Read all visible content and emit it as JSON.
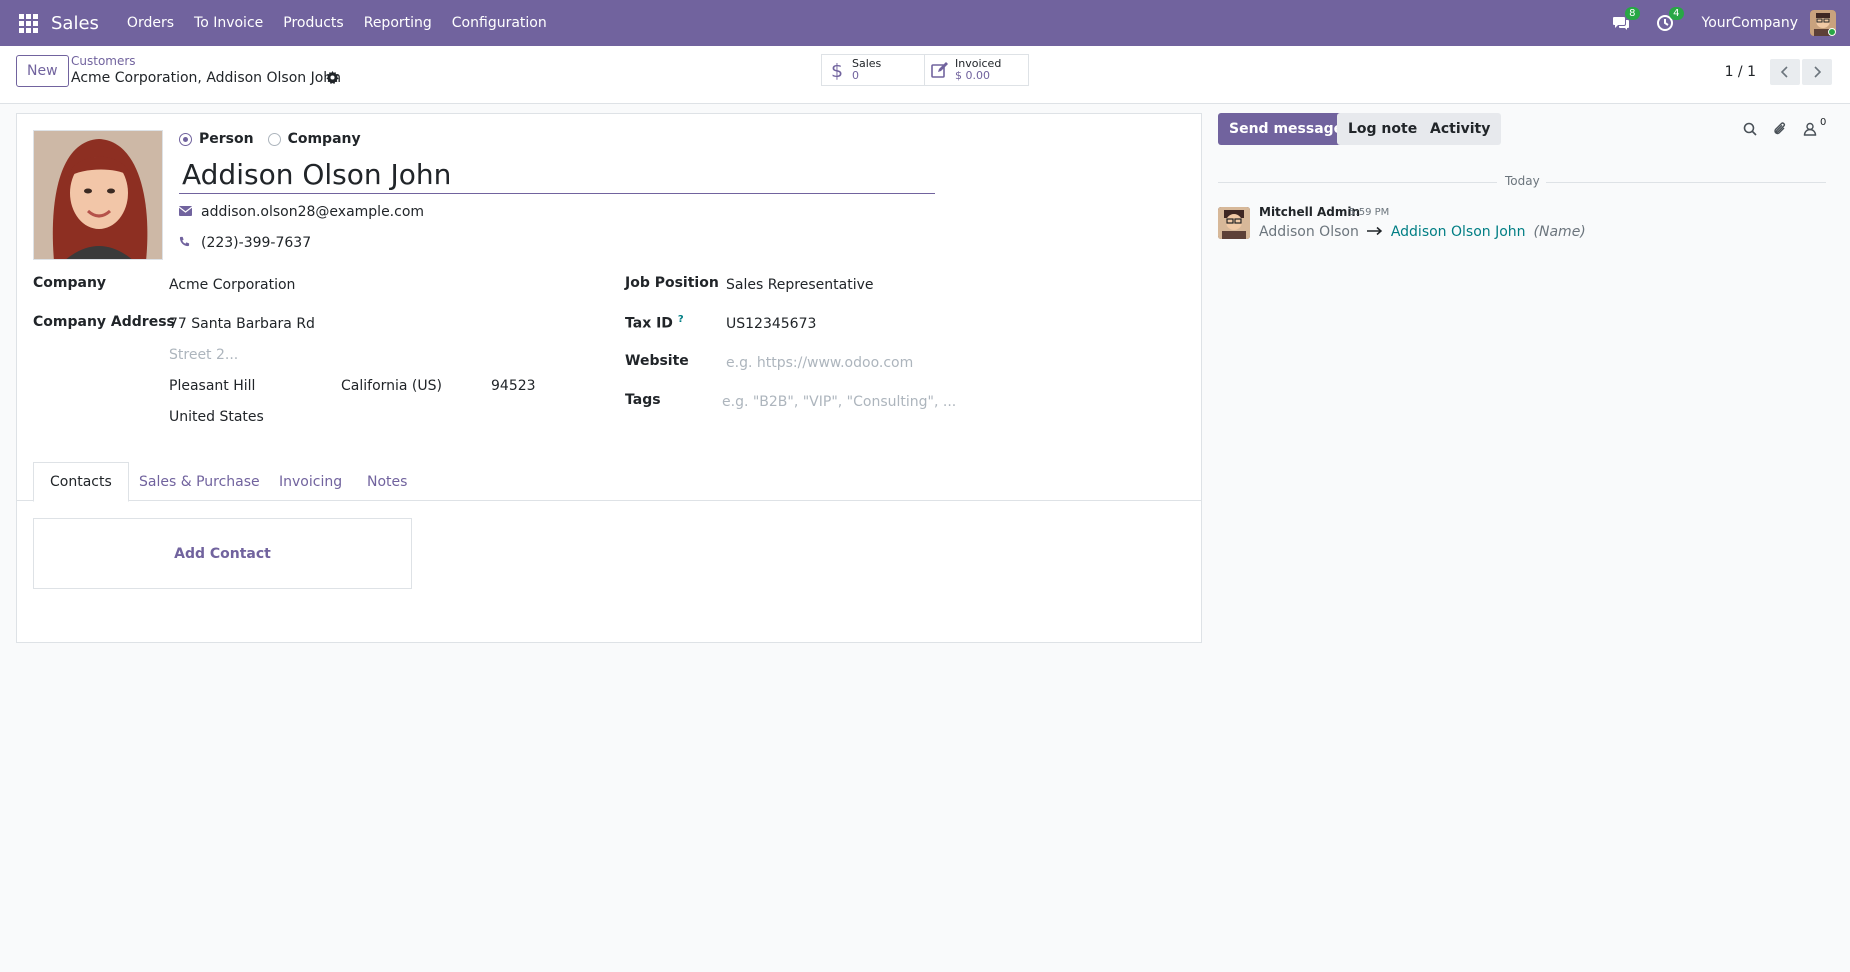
{
  "navbar": {
    "app_name": "Sales",
    "menu": [
      "Orders",
      "To Invoice",
      "Products",
      "Reporting",
      "Configuration"
    ],
    "messages_badge": "8",
    "activities_badge": "4",
    "company": "YourCompany"
  },
  "control_panel": {
    "new_label": "New",
    "breadcrumb_parent": "Customers",
    "breadcrumb_current": "Acme Corporation, Addison Olson John",
    "smart_buttons": [
      {
        "label": "Sales",
        "value": "0",
        "icon": "dollar-icon"
      },
      {
        "label": "Invoiced",
        "value": "$ 0.00",
        "icon": "edit-invoice-icon"
      }
    ],
    "pager": "1 / 1"
  },
  "form": {
    "type_options": [
      {
        "label": "Person",
        "checked": true
      },
      {
        "label": "Company",
        "checked": false
      }
    ],
    "name": "Addison Olson John",
    "email": "addison.olson28@example.com",
    "phone": "(223)-399-7637",
    "company_label": "Company",
    "company_value": "Acme Corporation",
    "address_label": "Company Address",
    "street": "77 Santa Barbara Rd",
    "street2_placeholder": "Street 2...",
    "city": "Pleasant Hill",
    "state": "California (US)",
    "zip": "94523",
    "country": "United States",
    "job_label": "Job Position",
    "job_value": "Sales Representative",
    "tax_label": "Tax ID",
    "tax_help": "?",
    "tax_value": "US12345673",
    "website_label": "Website",
    "website_placeholder": "e.g. https://www.odoo.com",
    "tags_label": "Tags",
    "tags_placeholder": "e.g. \"B2B\", \"VIP\", \"Consulting\", ..."
  },
  "tabs": [
    "Contacts",
    "Sales & Purchase",
    "Invoicing",
    "Notes"
  ],
  "active_tab": "Contacts",
  "add_contact": "Add Contact",
  "chatter": {
    "send_message": "Send message",
    "log_note": "Log note",
    "activity": "Activity",
    "followers_count": "0",
    "separator": "Today",
    "message": {
      "author": "Mitchell Admin",
      "time": "5:59 PM",
      "old_value": "Addison Olson",
      "new_value": "Addison Olson John",
      "field": "(Name)"
    }
  },
  "colors": {
    "brand": "#71639e",
    "link_teal": "#017e84",
    "badge_green": "#28a745"
  }
}
